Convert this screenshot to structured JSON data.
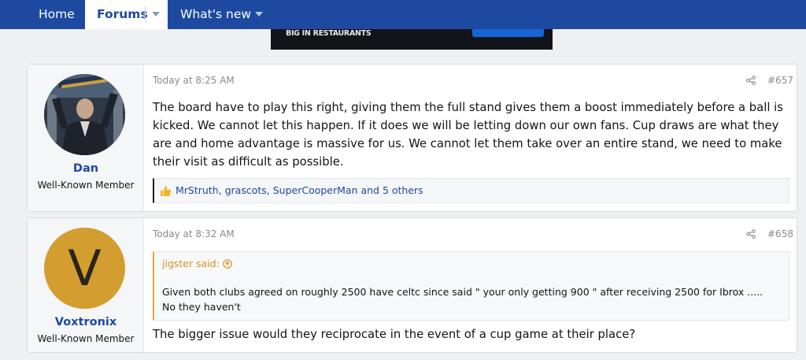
{
  "nav": {
    "home": "Home",
    "forums": "Forums",
    "whats_new": "What's new"
  },
  "ad": {
    "text": "BIG IN RESTAURANTS"
  },
  "posts": [
    {
      "username": "Dan",
      "user_title": "Well-Known Member",
      "avatar_icon": "user-photo-avatar",
      "date": "Today at 8:25 AM",
      "post_number": "#657",
      "body": "The board have to play this right, giving them the full stand gives them a boost immediately before a ball is kicked. We cannot let this happen. If it does we will be letting down our own fans. Cup draws are what they are and home advantage is massive for us. We cannot let them take over an entire stand, we need to make their visit as difficult as possible.",
      "reactions": "MrStruth, grascots, SuperCooperMan and 5 others"
    },
    {
      "username": "Voxtronix",
      "user_title": "Well-Known Member",
      "avatar_letter": "V",
      "avatar_color": "#d39e2f",
      "date": "Today at 8:32 AM",
      "post_number": "#658",
      "quote": {
        "author": "jigster said:",
        "line1": "Given both clubs agreed on roughly 2500 have celtc since said \" your only getting 900 \" after receiving 2500 for Ibrox .....",
        "line2": "No they haven't"
      },
      "body": "The bigger issue would they reciprocate in the event of a cup game at their place?"
    }
  ],
  "colors": {
    "nav_bg": "#1d4aa0",
    "link": "#1d4aa0",
    "quote_accent": "#f0a830"
  }
}
